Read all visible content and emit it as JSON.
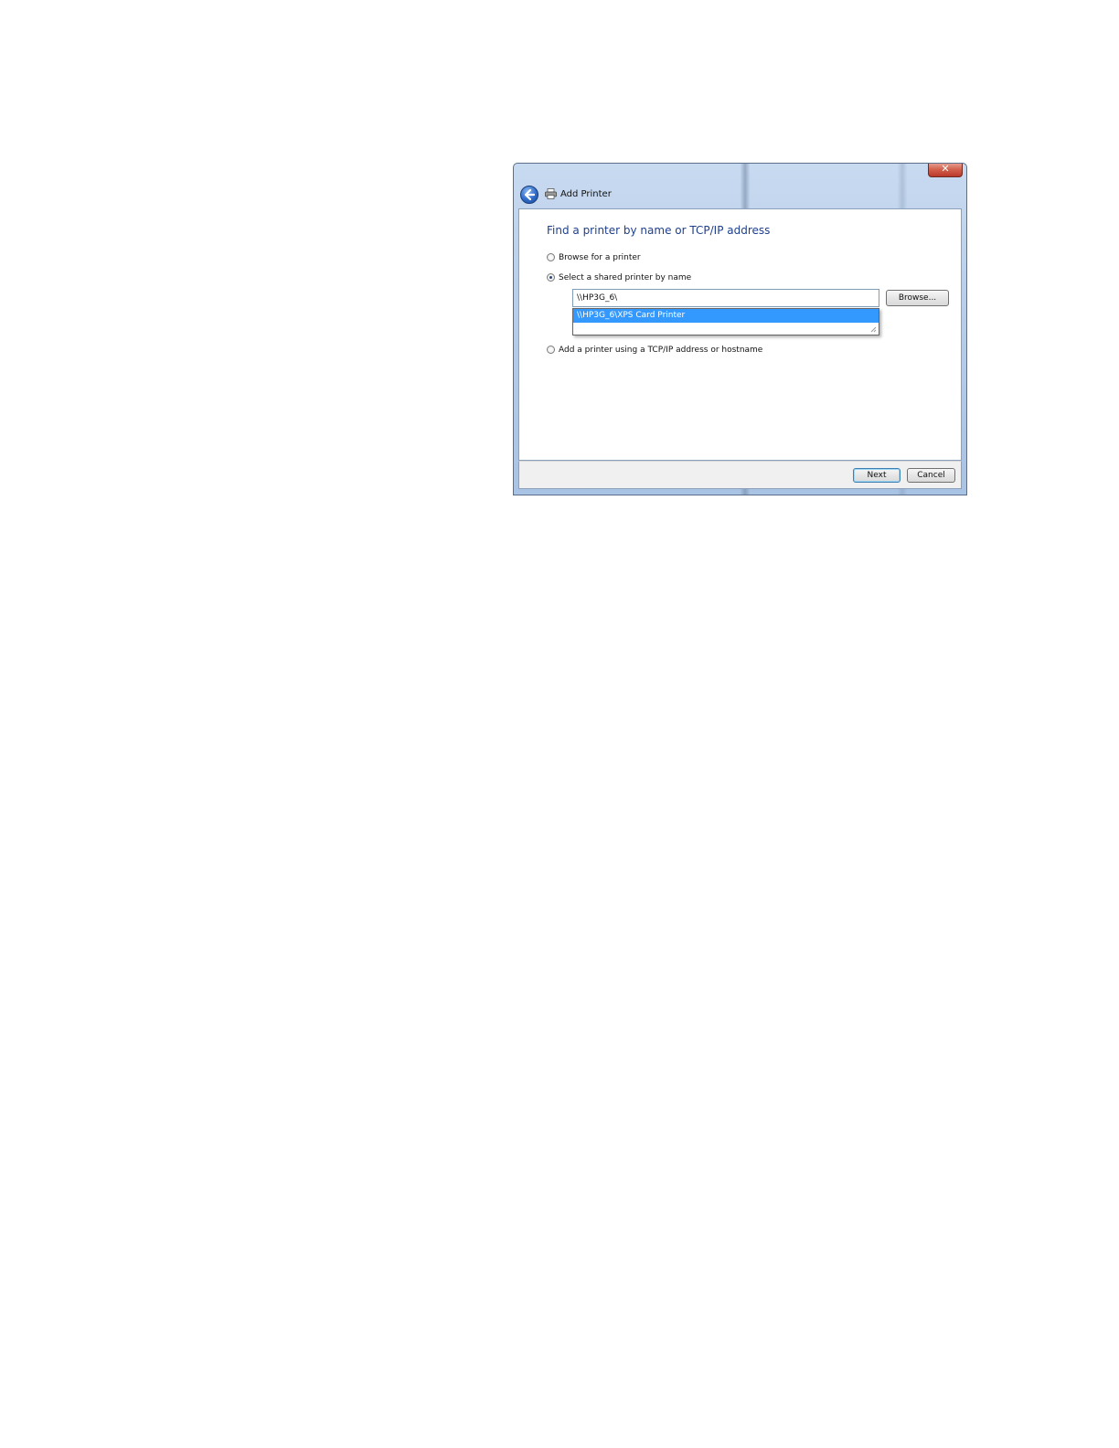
{
  "window": {
    "title": "Add Printer",
    "close_glyph": "✕"
  },
  "content": {
    "heading": "Find a printer by name or TCP/IP address",
    "options": [
      {
        "label": "Browse for a printer",
        "checked": false
      },
      {
        "label": "Select a shared printer by name",
        "checked": true
      },
      {
        "label": "Add a printer using a TCP/IP address or hostname",
        "checked": false
      }
    ],
    "printer_name_value": "\\\\HP3G_6\\",
    "browse_label": "Browse...",
    "suggestions": [
      "\\\\HP3G_6\\XPS Card Printer"
    ]
  },
  "footer": {
    "next_label": "Next",
    "cancel_label": "Cancel"
  },
  "icons": {
    "back": "back-arrow-icon",
    "printer": "printer-icon",
    "close": "close-icon",
    "grip": "resize-grip-icon"
  },
  "colors": {
    "heading": "#1e3f8c",
    "selection": "#3399ff",
    "close_button": "#c8473a"
  }
}
